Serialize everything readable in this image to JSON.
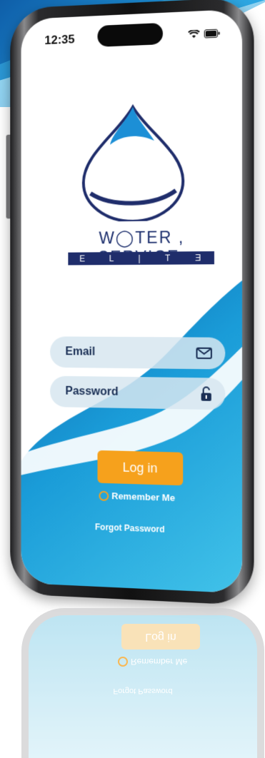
{
  "status_bar": {
    "time": "12:35"
  },
  "logo": {
    "word1": "W◯TER",
    "word2": "SERVICE",
    "tm": "™",
    "letters": [
      "E",
      "L",
      "|",
      "T",
      "Ǝ"
    ]
  },
  "form": {
    "email_placeholder": "Email",
    "password_placeholder": "Password",
    "login_label": "Log in",
    "remember_label": "Remember Me",
    "forgot_label": "Forgot Password"
  },
  "colors": {
    "accent": "#f6a11c",
    "brand": "#1f2d6b",
    "wave": "#1a9cd8"
  },
  "icons": {
    "email": "envelope-icon",
    "password": "unlock-icon"
  }
}
